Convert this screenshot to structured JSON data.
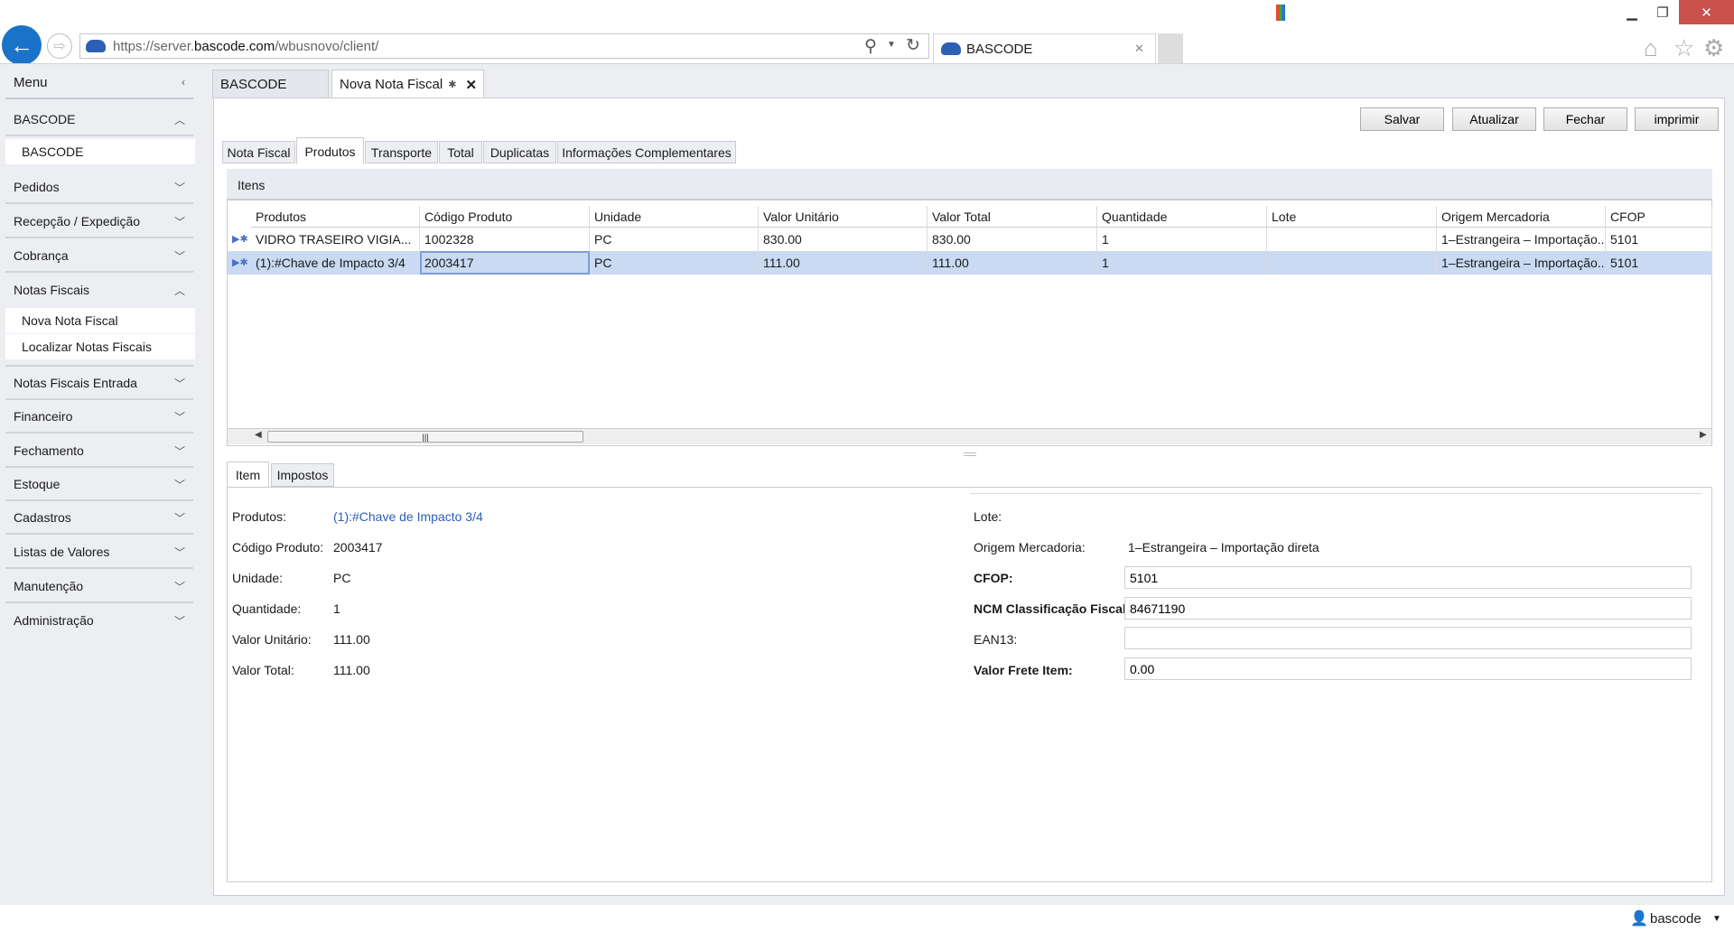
{
  "browser": {
    "url_prefix": "https://server.",
    "url_domain": "bascode.com",
    "url_path": "/wbusnovo/client/",
    "tab_title": "BASCODE",
    "tab_close": "✕"
  },
  "sidebar": {
    "title": "Menu",
    "groups": [
      {
        "label": "BASCODE",
        "expanded": true,
        "items": [
          "BASCODE"
        ]
      },
      {
        "label": "Pedidos"
      },
      {
        "label": "Recepção / Expedição"
      },
      {
        "label": "Cobrança"
      },
      {
        "label": "Notas Fiscais",
        "expanded": true,
        "items": [
          "Nova Nota Fiscal",
          "Localizar Notas Fiscais"
        ]
      },
      {
        "label": "Notas Fiscais Entrada"
      },
      {
        "label": "Financeiro"
      },
      {
        "label": "Fechamento"
      },
      {
        "label": "Estoque"
      },
      {
        "label": "Cadastros"
      },
      {
        "label": "Listas de Valores"
      },
      {
        "label": "Manutenção"
      },
      {
        "label": "Administração"
      }
    ]
  },
  "main_tabs": [
    {
      "label": "BASCODE"
    },
    {
      "label": "Nova Nota Fiscal",
      "modified": "✱",
      "close": "✕"
    }
  ],
  "toolbar": {
    "salvar": "Salvar",
    "atualizar": "Atualizar",
    "fechar": "Fechar",
    "imprimir": "imprimir"
  },
  "sub_tabs": [
    "Nota Fiscal",
    "Produtos",
    "Transporte",
    "Total",
    "Duplicatas",
    "Informações Complementares"
  ],
  "active_sub_tab": "Produtos",
  "itens": {
    "title": "Itens",
    "columns": [
      "Produtos",
      "Código Produto",
      "Unidade",
      "Valor Unitário",
      "Valor Total",
      "Quantidade",
      "Lote",
      "Origem Mercadoria",
      "CFOP"
    ],
    "rows": [
      [
        "VIDRO TRASEIRO VIGIA...",
        "1002328",
        "PC",
        "830.00",
        "830.00",
        "1",
        "",
        "1–Estrangeira – Importação...",
        "5101"
      ],
      [
        "(1):#Chave de Impacto 3/4",
        "2003417",
        "PC",
        "111.00",
        "111.00",
        "1",
        "",
        "1–Estrangeira – Importação...",
        "5101"
      ]
    ],
    "selected_row": 1
  },
  "detail_tabs": [
    "Item",
    "Impostos"
  ],
  "detail": {
    "left": [
      {
        "label": "Produtos:",
        "value": "(1):#Chave de Impacto 3/4"
      },
      {
        "label": "Código Produto:",
        "value": "2003417"
      },
      {
        "label": "Unidade:",
        "value": "PC"
      },
      {
        "label": "Quantidade:",
        "value": "1"
      },
      {
        "label": "Valor Unitário:",
        "value": "111.00"
      },
      {
        "label": "Valor Total:",
        "value": "111.00"
      }
    ],
    "lote_label": "Lote:",
    "lote_value": "",
    "origem_label": "Origem Mercadoria:",
    "origem_value": "1–Estrangeira – Importação direta",
    "cfop_label": "CFOP:",
    "cfop_value": "5101",
    "ncm_label": "NCM Classificação Fiscal:",
    "ncm_value": "84671190",
    "ean_label": "EAN13:",
    "ean_value": "",
    "frete_label": "Valor Frete Item:",
    "frete_value": "0.00"
  },
  "status": {
    "user": "bascode"
  },
  "colors": {
    "accent": "#1a73c8",
    "selected_row": "#c9daf2",
    "close": "#c9504c",
    "link": "#2b5fb4"
  }
}
